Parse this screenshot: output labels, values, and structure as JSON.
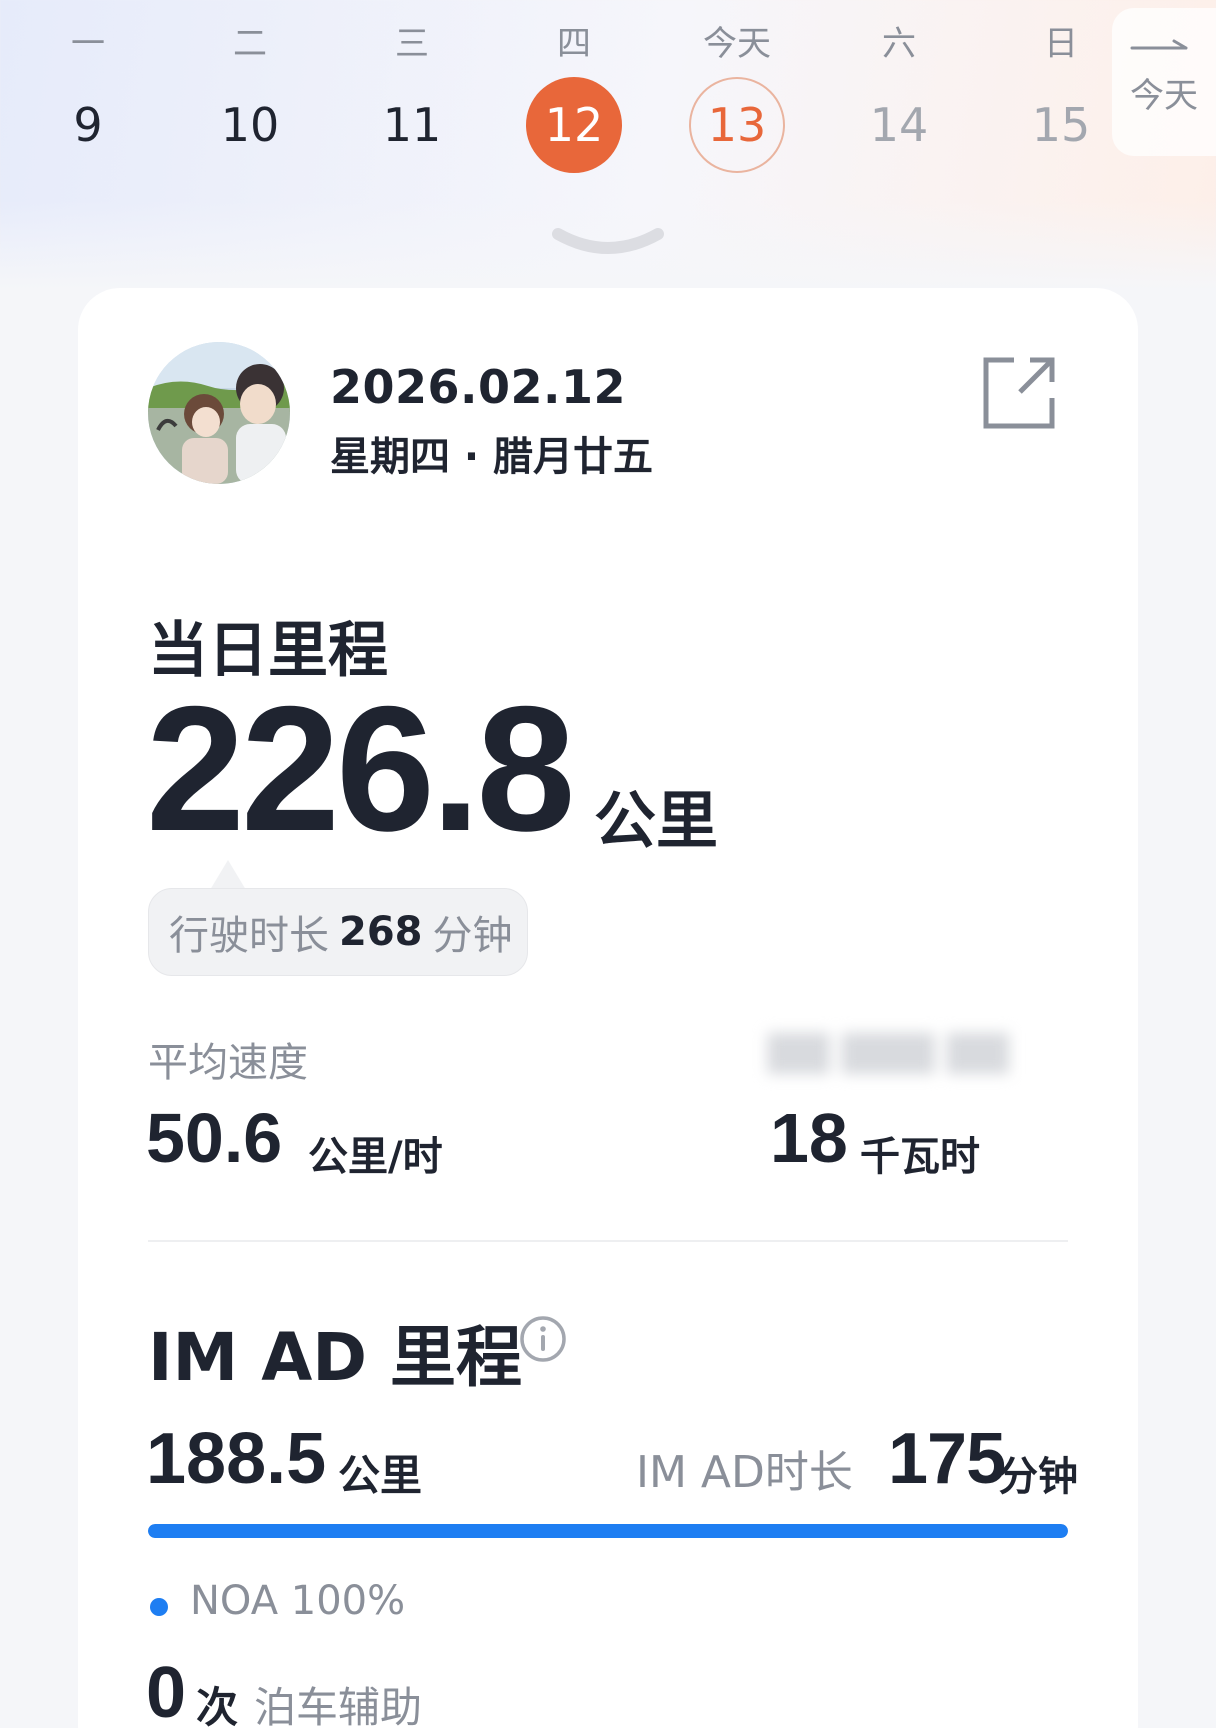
{
  "week": {
    "days": [
      {
        "weekday": "一",
        "date": "9"
      },
      {
        "weekday": "二",
        "date": "10"
      },
      {
        "weekday": "三",
        "date": "11"
      },
      {
        "weekday": "四",
        "date": "12"
      },
      {
        "weekday": "今天",
        "date": "13"
      },
      {
        "weekday": "六",
        "date": "14"
      },
      {
        "weekday": "日",
        "date": "15"
      }
    ],
    "today_button": "今天",
    "selected_color": "#e8673a"
  },
  "header": {
    "date": "2026.02.12",
    "subtitle": "星期四 · 腊月廿五"
  },
  "mileage": {
    "title": "当日里程",
    "value": "226.8",
    "unit": "公里",
    "duration_label": "行驶时长",
    "duration_value": "268",
    "duration_unit": "分钟"
  },
  "stats": {
    "avg_speed_label": "平均速度",
    "avg_speed_value": "50.6",
    "avg_speed_unit": "公里/时",
    "energy_label_blurred": "",
    "energy_value": "18",
    "energy_unit": "千瓦时"
  },
  "im_ad": {
    "title": "IM AD 里程",
    "km_value": "188.5",
    "km_unit": "公里",
    "duration_label": "IM AD时长",
    "duration_value": "175",
    "duration_unit": "分钟",
    "progress_fraction": 1.0,
    "progress_color": "#1e7ef2",
    "noa_label": "NOA 100%",
    "parking_count": "0",
    "parking_unit": "次",
    "parking_label": "泊车辅助"
  }
}
